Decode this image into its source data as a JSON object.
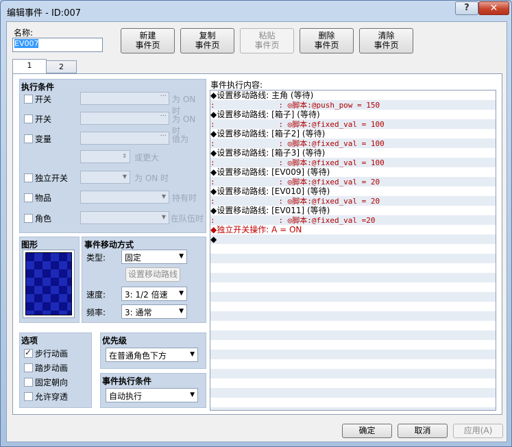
{
  "window": {
    "title": "编辑事件 - ID:007",
    "help_label": "?",
    "close_label": "✕"
  },
  "name": {
    "label": "名称:",
    "value": "EV007"
  },
  "toolbar": {
    "new_line1": "新建",
    "new_line2": "事件页",
    "copy_line1": "复制",
    "copy_line2": "事件页",
    "paste_line1": "粘贴",
    "paste_line2": "事件页",
    "delete_line1": "删除",
    "delete_line2": "事件页",
    "clear_line1": "清除",
    "clear_line2": "事件页"
  },
  "tabs": [
    "1",
    "2"
  ],
  "conditions": {
    "title": "执行条件",
    "switch1_label": "开关",
    "switch1_suffix": "为 ON 时",
    "switch2_label": "开关",
    "switch2_suffix": "为 ON 时",
    "variable_label": "变量",
    "variable_suffix": "值为",
    "variable_more": "或更大",
    "self_switch_label": "独立开关",
    "self_switch_suffix": "为 ON 时",
    "item_label": "物品",
    "item_suffix": "持有时",
    "actor_label": "角色",
    "actor_suffix": "在队伍时"
  },
  "graphic": {
    "title": "图形"
  },
  "movement": {
    "title": "事件移动方式",
    "type_label": "类型:",
    "type_value": "固定",
    "route_button": "设置移动路线",
    "speed_label": "速度:",
    "speed_value": "3: 1/2 倍速",
    "freq_label": "频率:",
    "freq_value": "3: 通常"
  },
  "options": {
    "title": "选项",
    "walk_anim": "步行动画",
    "walk_anim_checked": true,
    "step_anim": "踏步动画",
    "step_anim_checked": false,
    "dir_fix": "固定朝向",
    "dir_fix_checked": false,
    "through": "允许穿透",
    "through_checked": false
  },
  "priority": {
    "title": "优先级",
    "value": "在普通角色下方"
  },
  "trigger": {
    "title": "事件执行条件",
    "value": "自动执行"
  },
  "content": {
    "label": "事件执行内容:",
    "lines": [
      {
        "text": "◆设置移动路线: 主角 (等待)",
        "kind": "main"
      },
      {
        "text": ":              : ◎脚本:@push_pow = 150",
        "kind": "sub"
      },
      {
        "text": "◆设置移动路线: [箱子] (等待)",
        "kind": "main"
      },
      {
        "text": ":              : ◎脚本:@fixed_val = 100",
        "kind": "sub"
      },
      {
        "text": "◆设置移动路线: [箱子2] (等待)",
        "kind": "main"
      },
      {
        "text": ":              : ◎脚本:@fixed_val = 100",
        "kind": "sub"
      },
      {
        "text": "◆设置移动路线: [箱子3] (等待)",
        "kind": "main"
      },
      {
        "text": ":              : ◎脚本:@fixed_val = 100",
        "kind": "sub"
      },
      {
        "text": "◆设置移动路线: [EV009] (等待)",
        "kind": "main"
      },
      {
        "text": ":              : ◎脚本:@fixed_val = 20",
        "kind": "sub"
      },
      {
        "text": "◆设置移动路线: [EV010] (等待)",
        "kind": "main"
      },
      {
        "text": ":              : ◎脚本:@fixed_val = 20",
        "kind": "sub"
      },
      {
        "text": "◆设置移动路线: [EV011] (等待)",
        "kind": "main"
      },
      {
        "text": ":              : ◎脚本:@fixed_val =20",
        "kind": "sub"
      },
      {
        "text": "◆独立开关操作: A = ON",
        "kind": "red"
      },
      {
        "text": "◆",
        "kind": "main"
      }
    ]
  },
  "footer": {
    "ok": "确定",
    "cancel": "取消",
    "apply": "应用(A)"
  },
  "colors": {
    "accent": "#3399ff",
    "panel": "#c9d7e8",
    "command_red": "#c00000"
  }
}
